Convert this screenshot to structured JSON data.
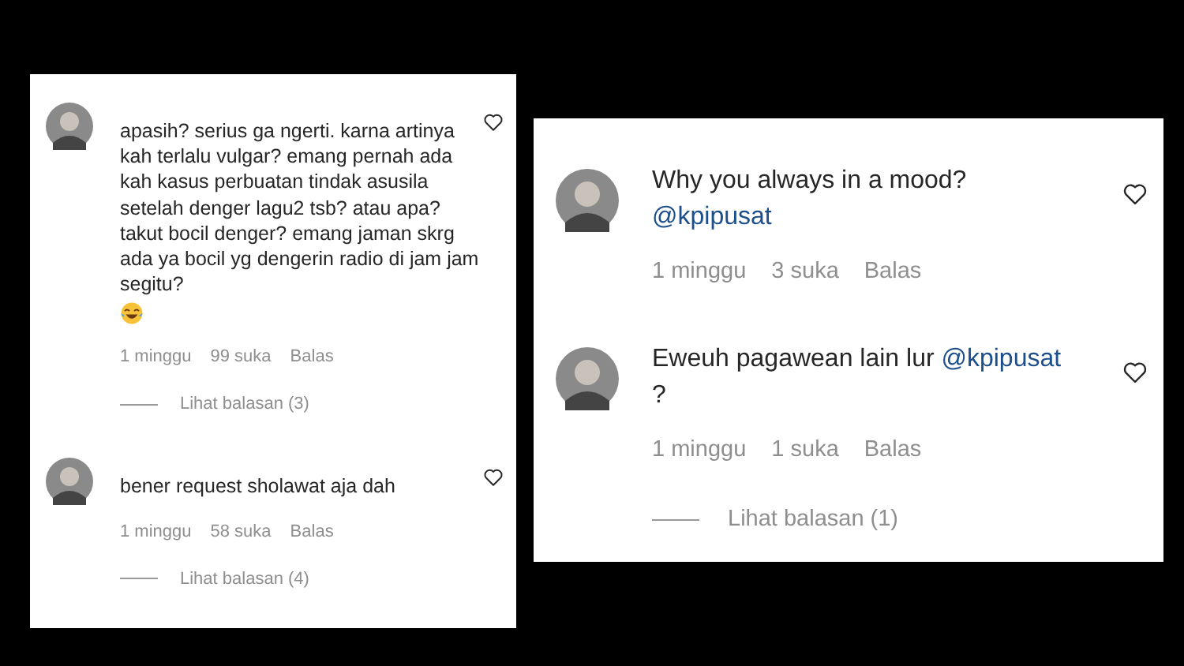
{
  "cards": [
    {
      "comments": [
        {
          "text": [
            {
              "kind": "plain",
              "text": "apasih? serius ga ngerti. karna artinya kah terlalu vulgar? emang pernah ada kah kasus perbuatan tindak asusila setelah denger lagu2 tsb? atau apa? takut bocil denger? emang jaman skrg ada ya bocil yg dengerin radio di jam jam segitu?"
            }
          ],
          "emoji": true,
          "time": "1 minggu",
          "likes": "99 suka",
          "reply": "Balas",
          "view_replies": "Lihat balasan (3)"
        },
        {
          "text": [
            {
              "kind": "plain",
              "text": "bener request sholawat aja dah"
            }
          ],
          "emoji": false,
          "time": "1 minggu",
          "likes": "58 suka",
          "reply": "Balas",
          "view_replies": "Lihat balasan (4)"
        }
      ]
    },
    {
      "comments": [
        {
          "text": [
            {
              "kind": "plain",
              "text": "Why you always in a mood? "
            },
            {
              "kind": "mention",
              "text": "@kpipusat"
            }
          ],
          "emoji": false,
          "time": "1 minggu",
          "likes": "3 suka",
          "reply": "Balas"
        },
        {
          "text": [
            {
              "kind": "plain",
              "text": "Eweuh pagawean lain lur "
            },
            {
              "kind": "mention",
              "text": "@kpipusat"
            },
            {
              "kind": "plain",
              "text": " ?"
            }
          ],
          "emoji": false,
          "time": "1 minggu",
          "likes": "1 suka",
          "reply": "Balas",
          "view_replies": "Lihat balasan (1)"
        }
      ]
    }
  ]
}
